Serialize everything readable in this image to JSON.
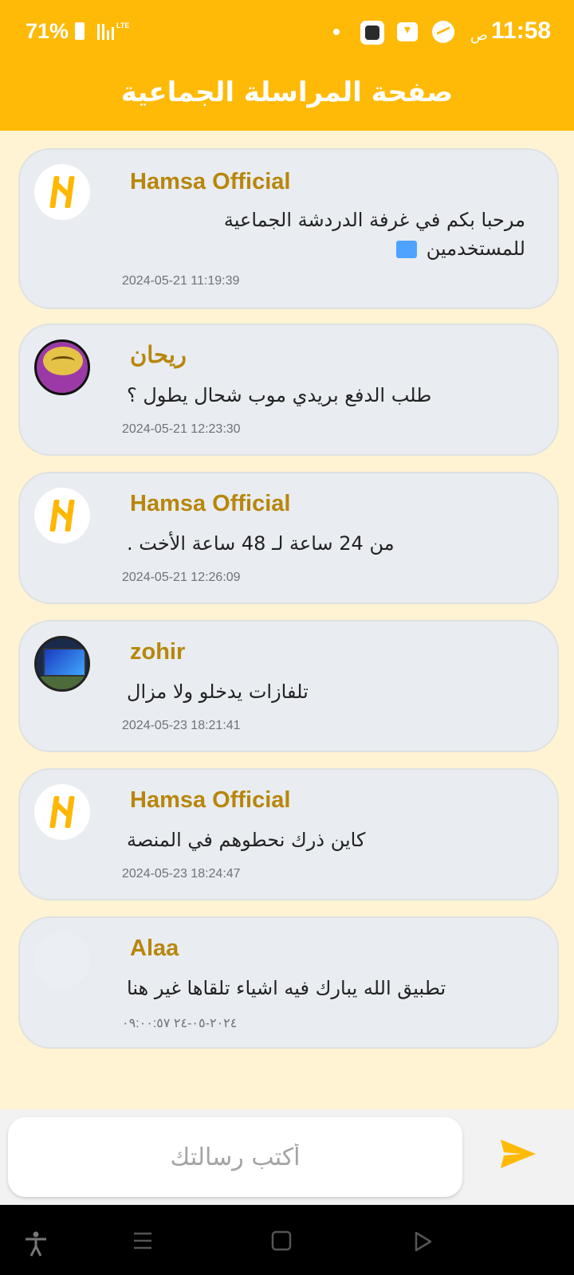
{
  "status_bar": {
    "battery_percent": "71%",
    "network": "LTE",
    "ampm": "ص",
    "clock": "11:58",
    "icons": [
      "battery-icon",
      "signal-icon",
      "dot-icon",
      "app-notification-icon",
      "download-icon",
      "messenger-icon"
    ]
  },
  "header": {
    "title": "صفحة المراسلة الجماعية",
    "background": "#ffba08"
  },
  "messages": [
    {
      "sender": "Hamsa Official",
      "text": "مرحبا بكم في غرفة الدردشة الجماعية للمستخدمين",
      "timestamp": "2024-05-21 11:19:39",
      "avatar": "hamsa-logo"
    },
    {
      "sender": "ريحان",
      "text": "طلب الدفع بريدي موب شحال يطول ؟",
      "timestamp": "2024-05-21 12:23:30",
      "avatar": "purple-emblem"
    },
    {
      "sender": "Hamsa Official",
      "text": "من 24 ساعة لـ 48 ساعة الأخت .",
      "timestamp": "2024-05-21 12:26:09",
      "avatar": "hamsa-logo"
    },
    {
      "sender": "zohir",
      "text": "تلفازات يدخلو ولا مزال",
      "timestamp": "2024-05-23 18:21:41",
      "avatar": "tv-photo"
    },
    {
      "sender": "Hamsa Official",
      "text": "كاين ذرك نحطوهم في المنصة",
      "timestamp": "2024-05-23 18:24:47",
      "avatar": "hamsa-logo"
    },
    {
      "sender": "Alaa",
      "text": "تطبيق الله يبارك فيه اشياء تلقاها غير هنا",
      "timestamp": "٢٠٢٤-٠٥-٢٤ ٠٩:٠٠:٥٧",
      "avatar": "blank"
    }
  ],
  "composer": {
    "placeholder": "أكتب رسالتك",
    "send_icon": "send-icon"
  },
  "colors": {
    "accent": "#ffba08",
    "sender_name": "#b8860b",
    "bubble": "#e9edf1",
    "chat_background": "#fff3d3"
  },
  "nav_bar": {
    "icons": [
      "accessibility-icon",
      "menu-icon",
      "home-icon",
      "back-icon"
    ]
  }
}
